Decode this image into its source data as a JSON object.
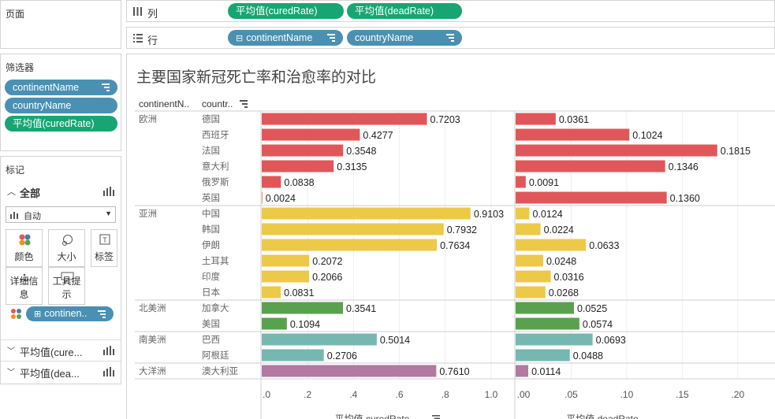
{
  "pages_panel": {
    "title": "页面"
  },
  "filters_panel": {
    "title": "筛选器",
    "items": [
      "continentName",
      "countryName",
      "平均值(curedRate)"
    ]
  },
  "marks_panel": {
    "title": "标记",
    "all_label": "全部",
    "type_value": "自动",
    "buttons": {
      "color": "颜色",
      "size": "大小",
      "label": "标签",
      "detail": "详细信息",
      "tooltip": "工具提示"
    },
    "color_field": "continen..",
    "sub_sections": [
      "平均值(cure...",
      "平均值(dea..."
    ]
  },
  "columns_shelf": {
    "label": "列",
    "pills": [
      "平均值(curedRate)",
      "平均值(deadRate)"
    ]
  },
  "rows_shelf": {
    "label": "行",
    "pills": [
      "continentName",
      "countryName"
    ]
  },
  "viz": {
    "title": "主要国家新冠死亡率和治愈率的对比",
    "col_headers": {
      "continent": "continentN..",
      "country": "countr.."
    },
    "x_axis_cured_title": "平均值 curedRate",
    "x_axis_dead_title": "平均值 deadRate",
    "x_ticks_cured": [
      ".0",
      ".2",
      ".4",
      ".6",
      ".8",
      "1.0"
    ],
    "x_ticks_dead": [
      ".00",
      ".05",
      ".10",
      ".15",
      ".20"
    ]
  },
  "colors": {
    "欧洲": "#e15759",
    "亚洲": "#edc948",
    "北美洲": "#59a14f",
    "南美洲": "#76b7b2",
    "大洋洲": "#b07aa1",
    "pill_blue": "#4a90b3",
    "pill_green": "#17a673"
  },
  "chart_data": {
    "type": "bar",
    "orientation": "horizontal",
    "x_domain_cured": [
      0,
      1.1
    ],
    "x_domain_dead": [
      0,
      0.22
    ],
    "groups": [
      {
        "continent": "欧洲",
        "rows": [
          {
            "country": "德国",
            "cured": 0.7203,
            "dead": 0.0361,
            "cured_label": "0.7203",
            "dead_label": "0.0361"
          },
          {
            "country": "西班牙",
            "cured": 0.4277,
            "dead": 0.1024,
            "cured_label": "0.4277",
            "dead_label": "0.1024"
          },
          {
            "country": "法国",
            "cured": 0.3548,
            "dead": 0.1815,
            "cured_label": "0.3548",
            "dead_label": "0.1815"
          },
          {
            "country": "意大利",
            "cured": 0.3135,
            "dead": 0.1346,
            "cured_label": "0.3135",
            "dead_label": "0.1346"
          },
          {
            "country": "俄罗斯",
            "cured": 0.0838,
            "dead": 0.0091,
            "cured_label": "0.0838",
            "dead_label": "0.0091"
          },
          {
            "country": "英国",
            "cured": 0.0024,
            "dead": 0.136,
            "cured_label": "0.0024",
            "dead_label": "0.1360"
          }
        ]
      },
      {
        "continent": "亚洲",
        "rows": [
          {
            "country": "中国",
            "cured": 0.9103,
            "dead": 0.0124,
            "cured_label": "0.9103",
            "dead_label": "0.0124"
          },
          {
            "country": "韩国",
            "cured": 0.7932,
            "dead": 0.0224,
            "cured_label": "0.7932",
            "dead_label": "0.0224"
          },
          {
            "country": "伊朗",
            "cured": 0.7634,
            "dead": 0.0633,
            "cured_label": "0.7634",
            "dead_label": "0.0633"
          },
          {
            "country": "土耳其",
            "cured": 0.2072,
            "dead": 0.0248,
            "cured_label": "0.2072",
            "dead_label": "0.0248"
          },
          {
            "country": "印度",
            "cured": 0.2066,
            "dead": 0.0316,
            "cured_label": "0.2066",
            "dead_label": "0.0316"
          },
          {
            "country": "日本",
            "cured": 0.0831,
            "dead": 0.0268,
            "cured_label": "0.0831",
            "dead_label": "0.0268"
          }
        ]
      },
      {
        "continent": "北美洲",
        "rows": [
          {
            "country": "加拿大",
            "cured": 0.3541,
            "dead": 0.0525,
            "cured_label": "0.3541",
            "dead_label": "0.0525"
          },
          {
            "country": "美国",
            "cured": 0.1094,
            "dead": 0.0574,
            "cured_label": "0.1094",
            "dead_label": "0.0574"
          }
        ]
      },
      {
        "continent": "南美洲",
        "rows": [
          {
            "country": "巴西",
            "cured": 0.5014,
            "dead": 0.0693,
            "cured_label": "0.5014",
            "dead_label": "0.0693"
          },
          {
            "country": "阿根廷",
            "cured": 0.2706,
            "dead": 0.0488,
            "cured_label": "0.2706",
            "dead_label": "0.0488"
          }
        ]
      },
      {
        "continent": "大洋洲",
        "rows": [
          {
            "country": "澳大利亚",
            "cured": 0.761,
            "dead": 0.0114,
            "cured_label": "0.7610",
            "dead_label": "0.0114"
          }
        ]
      }
    ]
  }
}
